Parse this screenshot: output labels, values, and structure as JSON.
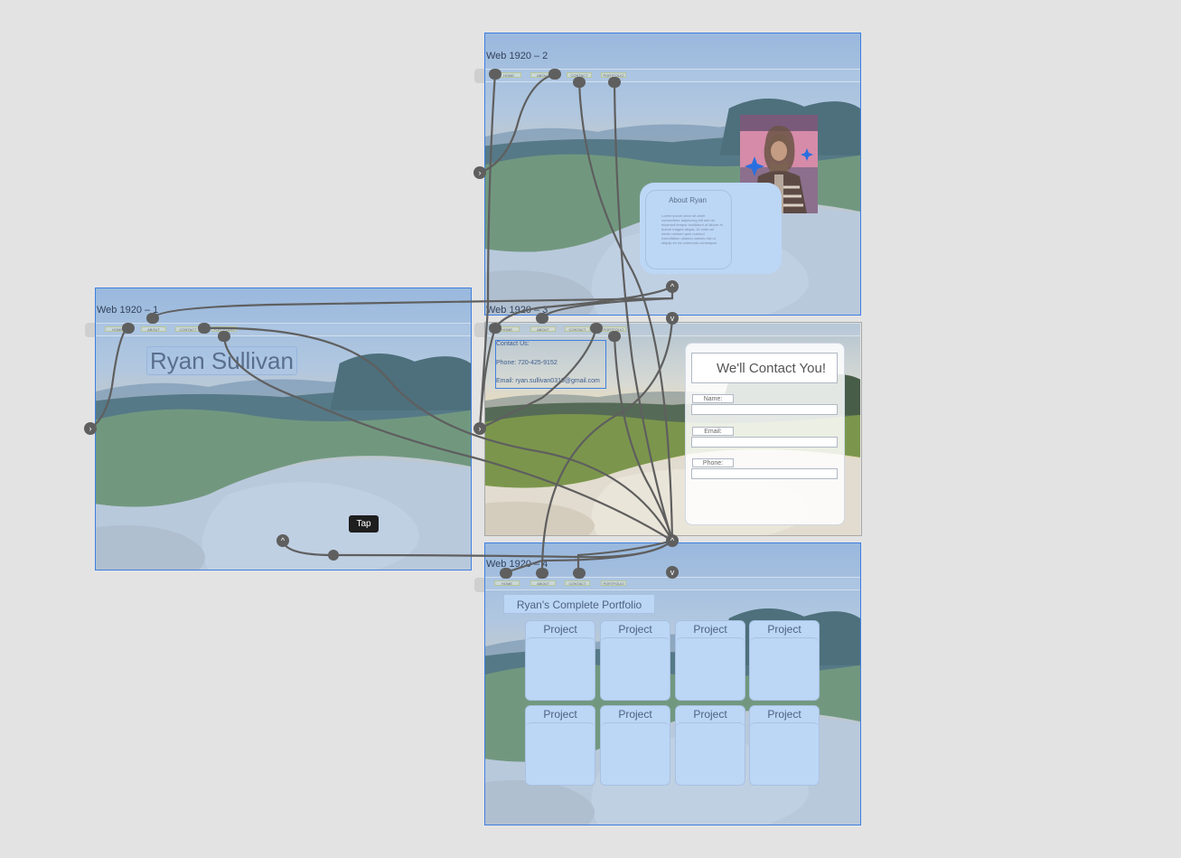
{
  "canvas": {
    "background": "#e3e3e3",
    "selection_color": "#3f7fe0",
    "wire_color": "#5f5f5f"
  },
  "artboards": [
    {
      "id": "web-1",
      "title": "Web 1920 – 1"
    },
    {
      "id": "web-2",
      "title": "Web 1920 – 2"
    },
    {
      "id": "web-3",
      "title": "Web 1920 – 3"
    },
    {
      "id": "web-4",
      "title": "Web 1920 – 4"
    }
  ],
  "nav": {
    "items": [
      "HOME",
      "ABOUT",
      "CONTACT",
      "PORTFOLIO"
    ]
  },
  "home": {
    "name": "Ryan Sullivan"
  },
  "about": {
    "title": "About Ryan",
    "body": "Lorem ipsum dolor sit amet consectetur adipiscing elit sed do eiusmod tempor incididunt ut labore et dolore magna aliqua. Ut enim ad minim veniam quis nostrud exercitation ullamco laboris nisi ut aliquip ex ea commodo consequat.",
    "photo_icon": "portrait-photo"
  },
  "contact": {
    "heading": "Contact Us:",
    "phone": "Phone: 720-425-9152",
    "email": "Email: ryan.sullivan0319@gmail.com",
    "form": {
      "title": "We'll Contact You!",
      "fields": [
        "Name:",
        "Email:",
        "Phone:"
      ]
    }
  },
  "portfolio": {
    "title": "Ryan's Complete Portfolio",
    "projects": [
      "Project",
      "Project",
      "Project",
      "Project",
      "Project",
      "Project",
      "Project",
      "Project"
    ]
  },
  "tooltip": {
    "label": "Tap"
  },
  "icons": {
    "scroll_up": "chevron-up-icon",
    "scroll_down": "chevron-down-icon",
    "flow_start": "chevron-right-icon"
  }
}
